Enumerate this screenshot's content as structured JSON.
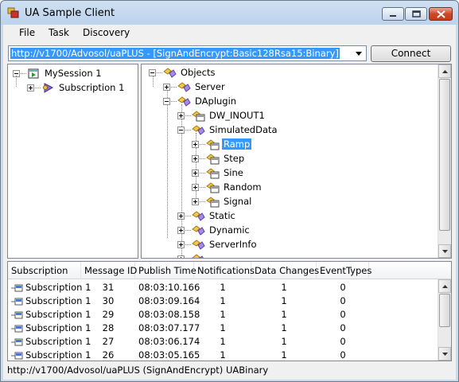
{
  "window": {
    "title": "UA Sample Client"
  },
  "menu": {
    "file": "File",
    "task": "Task",
    "discovery": "Discovery"
  },
  "toolbar": {
    "endpoint_value": "http://v1700/Advosol/uaPLUS - [SignAndEncrypt:Basic128Rsa15:Binary]",
    "connect_label": "Connect"
  },
  "session_tree": {
    "session": "MySession 1",
    "subscription": "Subscription 1"
  },
  "address_tree": {
    "objects": "Objects",
    "server": "Server",
    "daplugin": "DAplugin",
    "dw_inout1": "DW_INOUT1",
    "simulated_data": "SimulatedData",
    "ramp": "Ramp",
    "step": "Step",
    "sine": "Sine",
    "random": "Random",
    "signal": "Signal",
    "static": "Static",
    "dynamic": "Dynamic",
    "server_info": "ServerInfo"
  },
  "notifications": {
    "columns": [
      "Subscription",
      "Message ID",
      "Publish Time",
      "Notifications",
      "Data Changes",
      "EventTypes"
    ],
    "rows": [
      {
        "subscription": "Subscription 1",
        "message_id": "31",
        "publish_time": "08:03:10.166",
        "notifications": "1",
        "data_changes": "1",
        "event_types": "0"
      },
      {
        "subscription": "Subscription 1",
        "message_id": "30",
        "publish_time": "08:03:09.164",
        "notifications": "1",
        "data_changes": "1",
        "event_types": "0"
      },
      {
        "subscription": "Subscription 1",
        "message_id": "29",
        "publish_time": "08:03:08.158",
        "notifications": "1",
        "data_changes": "1",
        "event_types": "0"
      },
      {
        "subscription": "Subscription 1",
        "message_id": "28",
        "publish_time": "08:03:07.177",
        "notifications": "1",
        "data_changes": "1",
        "event_types": "0"
      },
      {
        "subscription": "Subscription 1",
        "message_id": "27",
        "publish_time": "08:03:06.174",
        "notifications": "1",
        "data_changes": "1",
        "event_types": "0"
      },
      {
        "subscription": "Subscription 1",
        "message_id": "26",
        "publish_time": "08:03:05.165",
        "notifications": "1",
        "data_changes": "1",
        "event_types": "0"
      }
    ]
  },
  "status_bar": {
    "text": "http://v1700/Advosol/uaPLUS (SignAndEncrypt) UABinary"
  },
  "colors": {
    "selection": "#3399ff",
    "close_button": "#c84b2a"
  }
}
